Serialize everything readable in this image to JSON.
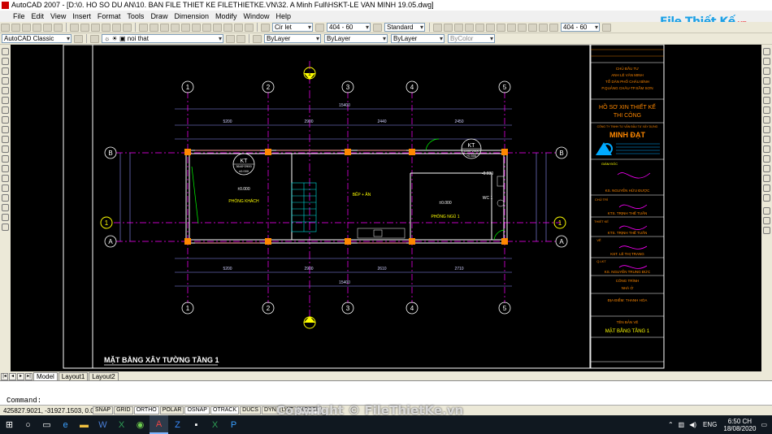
{
  "window": {
    "title": "AutoCAD 2007 - [D:\\0. HO SO DU AN\\10. BAN FILE THIET KE FILETHIETKE.VN\\32. A Minh Full\\HSKT-LE VAN MINH 19.05.dwg]"
  },
  "menu": [
    "File",
    "Edit",
    "View",
    "Insert",
    "Format",
    "Tools",
    "Draw",
    "Dimension",
    "Modify",
    "Window",
    "Help"
  ],
  "toolbar": {
    "text_style": "Cir let",
    "dim_style_1": "404 - 60",
    "table_style": "Standard",
    "dim_style_2": "404 - 60",
    "workspace": "AutoCAD Classic",
    "layer": "noi that",
    "color": "ByLayer",
    "linetype": "ByLayer",
    "lineweight": "ByLayer",
    "plot_style": "ByColor"
  },
  "logo": {
    "text": "File Thiết Kế",
    "suffix": ".vn"
  },
  "drawing": {
    "title": "MẶT BẰNG XÂY TƯỜNG TẦNG 1",
    "grid_cols": [
      "1",
      "2",
      "3",
      "4",
      "5"
    ],
    "grid_rows": [
      "B",
      "A"
    ],
    "marker_top_num": "1",
    "marker_side_num": "1",
    "dims_top": [
      "5200",
      "2900",
      "2440",
      "2450",
      "2610",
      "2710"
    ],
    "total_dim": "15400",
    "rooms": [
      {
        "tag": "KT",
        "size": "3640*2900",
        "level": "±0.000",
        "name": "PHÒNG KHÁCH",
        "area_level": "±0.000"
      },
      {
        "name": "BẾP + ĂN"
      },
      {
        "level": "±0.000",
        "name": "PHÒNG NGỦ 1"
      },
      {
        "tag": "KT",
        "size": "2200*2400",
        "level": "+0.500",
        "area_level": "-0.030",
        "name": "WC 1"
      }
    ]
  },
  "titleblock": {
    "owner_label": "CHỦ ĐẦU TƯ",
    "owner_name": "ANH LÊ VĂN MINH",
    "owner_addr": "TỔ DÂN PHỐ CHÂU BÌNH",
    "owner_addr2": "P.QUẢNG CHÂU-TP.SẦM SƠN",
    "doc_title": "HỒ SƠ XIN THIẾT KẾ",
    "doc_title2": "THI CÔNG",
    "company_line": "CÔNG TY TNHH TƯ VẤN ĐẦU TƯ XÂY DỰNG",
    "company": "MINH ĐẠT",
    "director_label": "GIÁM ĐỐC",
    "director": "KS. NGUYỄN HỮU ĐƯỢC",
    "chief_label": "CHỦ TRÌ",
    "chief": "KTS. TRỊNH THẾ TUẤN",
    "designer_label": "THIẾT KẾ",
    "designer": "KTS. TRỊNH THẾ TUẤN",
    "drafter_label": "VẼ",
    "drafter": "KST. LÊ THỊ TRANG",
    "checker_label": "Q.LKT",
    "checker": "KS. NGUYỄN TRUNG ĐỨC",
    "project_label": "CÔNG TRÌNH",
    "project": "NHÀ Ở",
    "location": "ĐỊA ĐIỂM: THANH HÓA",
    "sheet_label": "TÊN BẢN VẼ",
    "sheet": "MẶT BẰNG TẦNG 1"
  },
  "tabs": [
    "Model",
    "Layout1",
    "Layout2"
  ],
  "command_prompt": "Command:",
  "status": {
    "coords": "425827.9021, -31927.1503, 0.0000",
    "toggles": [
      "SNAP",
      "GRID",
      "ORTHO",
      "POLAR",
      "OSNAP",
      "OTRACK",
      "DUCS",
      "DYN",
      "LWT",
      "MODEL"
    ]
  },
  "watermark": "Copyright © FileThietKe.vn",
  "taskbar": {
    "language": "ENG",
    "time": "6:50 CH",
    "date": "18/08/2020"
  },
  "colors": {
    "grid_axis": "#ff00ff",
    "wall": "#ffffff",
    "accent": "#ff8800",
    "dims": "#9090ff"
  }
}
